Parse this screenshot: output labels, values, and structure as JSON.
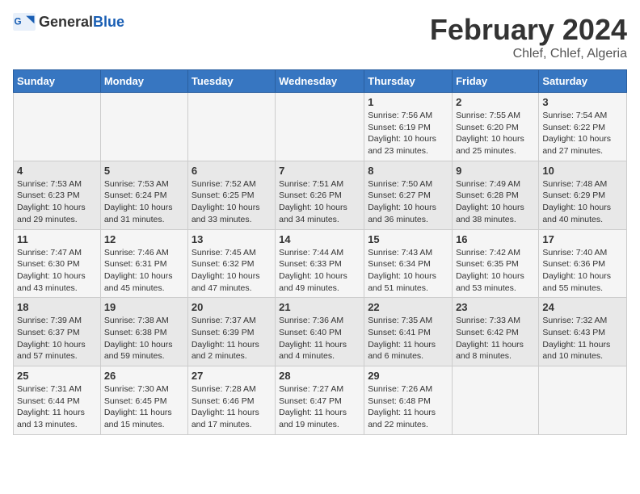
{
  "header": {
    "logo_general": "General",
    "logo_blue": "Blue",
    "title": "February 2024",
    "location": "Chlef, Chlef, Algeria"
  },
  "calendar": {
    "days_of_week": [
      "Sunday",
      "Monday",
      "Tuesday",
      "Wednesday",
      "Thursday",
      "Friday",
      "Saturday"
    ],
    "weeks": [
      [
        {
          "day": "",
          "info": ""
        },
        {
          "day": "",
          "info": ""
        },
        {
          "day": "",
          "info": ""
        },
        {
          "day": "",
          "info": ""
        },
        {
          "day": "1",
          "info": "Sunrise: 7:56 AM\nSunset: 6:19 PM\nDaylight: 10 hours and 23 minutes."
        },
        {
          "day": "2",
          "info": "Sunrise: 7:55 AM\nSunset: 6:20 PM\nDaylight: 10 hours and 25 minutes."
        },
        {
          "day": "3",
          "info": "Sunrise: 7:54 AM\nSunset: 6:22 PM\nDaylight: 10 hours and 27 minutes."
        }
      ],
      [
        {
          "day": "4",
          "info": "Sunrise: 7:53 AM\nSunset: 6:23 PM\nDaylight: 10 hours and 29 minutes."
        },
        {
          "day": "5",
          "info": "Sunrise: 7:53 AM\nSunset: 6:24 PM\nDaylight: 10 hours and 31 minutes."
        },
        {
          "day": "6",
          "info": "Sunrise: 7:52 AM\nSunset: 6:25 PM\nDaylight: 10 hours and 33 minutes."
        },
        {
          "day": "7",
          "info": "Sunrise: 7:51 AM\nSunset: 6:26 PM\nDaylight: 10 hours and 34 minutes."
        },
        {
          "day": "8",
          "info": "Sunrise: 7:50 AM\nSunset: 6:27 PM\nDaylight: 10 hours and 36 minutes."
        },
        {
          "day": "9",
          "info": "Sunrise: 7:49 AM\nSunset: 6:28 PM\nDaylight: 10 hours and 38 minutes."
        },
        {
          "day": "10",
          "info": "Sunrise: 7:48 AM\nSunset: 6:29 PM\nDaylight: 10 hours and 40 minutes."
        }
      ],
      [
        {
          "day": "11",
          "info": "Sunrise: 7:47 AM\nSunset: 6:30 PM\nDaylight: 10 hours and 43 minutes."
        },
        {
          "day": "12",
          "info": "Sunrise: 7:46 AM\nSunset: 6:31 PM\nDaylight: 10 hours and 45 minutes."
        },
        {
          "day": "13",
          "info": "Sunrise: 7:45 AM\nSunset: 6:32 PM\nDaylight: 10 hours and 47 minutes."
        },
        {
          "day": "14",
          "info": "Sunrise: 7:44 AM\nSunset: 6:33 PM\nDaylight: 10 hours and 49 minutes."
        },
        {
          "day": "15",
          "info": "Sunrise: 7:43 AM\nSunset: 6:34 PM\nDaylight: 10 hours and 51 minutes."
        },
        {
          "day": "16",
          "info": "Sunrise: 7:42 AM\nSunset: 6:35 PM\nDaylight: 10 hours and 53 minutes."
        },
        {
          "day": "17",
          "info": "Sunrise: 7:40 AM\nSunset: 6:36 PM\nDaylight: 10 hours and 55 minutes."
        }
      ],
      [
        {
          "day": "18",
          "info": "Sunrise: 7:39 AM\nSunset: 6:37 PM\nDaylight: 10 hours and 57 minutes."
        },
        {
          "day": "19",
          "info": "Sunrise: 7:38 AM\nSunset: 6:38 PM\nDaylight: 10 hours and 59 minutes."
        },
        {
          "day": "20",
          "info": "Sunrise: 7:37 AM\nSunset: 6:39 PM\nDaylight: 11 hours and 2 minutes."
        },
        {
          "day": "21",
          "info": "Sunrise: 7:36 AM\nSunset: 6:40 PM\nDaylight: 11 hours and 4 minutes."
        },
        {
          "day": "22",
          "info": "Sunrise: 7:35 AM\nSunset: 6:41 PM\nDaylight: 11 hours and 6 minutes."
        },
        {
          "day": "23",
          "info": "Sunrise: 7:33 AM\nSunset: 6:42 PM\nDaylight: 11 hours and 8 minutes."
        },
        {
          "day": "24",
          "info": "Sunrise: 7:32 AM\nSunset: 6:43 PM\nDaylight: 11 hours and 10 minutes."
        }
      ],
      [
        {
          "day": "25",
          "info": "Sunrise: 7:31 AM\nSunset: 6:44 PM\nDaylight: 11 hours and 13 minutes."
        },
        {
          "day": "26",
          "info": "Sunrise: 7:30 AM\nSunset: 6:45 PM\nDaylight: 11 hours and 15 minutes."
        },
        {
          "day": "27",
          "info": "Sunrise: 7:28 AM\nSunset: 6:46 PM\nDaylight: 11 hours and 17 minutes."
        },
        {
          "day": "28",
          "info": "Sunrise: 7:27 AM\nSunset: 6:47 PM\nDaylight: 11 hours and 19 minutes."
        },
        {
          "day": "29",
          "info": "Sunrise: 7:26 AM\nSunset: 6:48 PM\nDaylight: 11 hours and 22 minutes."
        },
        {
          "day": "",
          "info": ""
        },
        {
          "day": "",
          "info": ""
        }
      ]
    ]
  }
}
